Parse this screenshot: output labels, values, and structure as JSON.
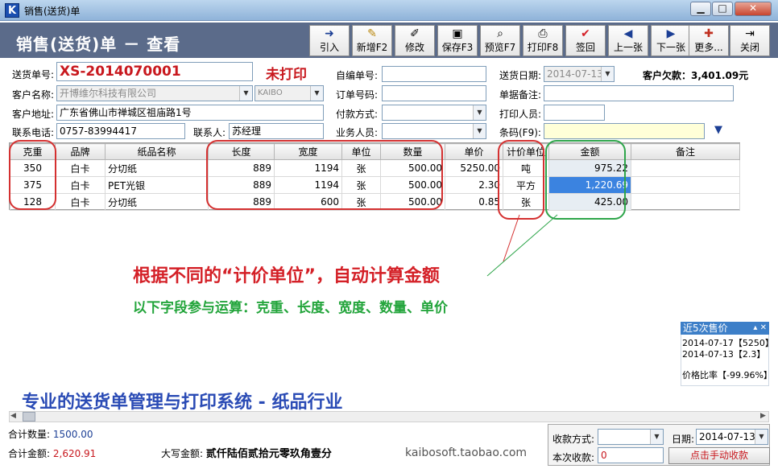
{
  "window": {
    "title": "销售(送货)单",
    "app_icon": "K"
  },
  "header": {
    "title": "销售(送货)单 － 查看"
  },
  "toolbar": [
    {
      "label": "引入",
      "icon": "➜"
    },
    {
      "label": "新增F2",
      "icon": "✎"
    },
    {
      "label": "修改",
      "icon": "✐"
    },
    {
      "label": "保存F3",
      "icon": "▣"
    },
    {
      "label": "预览F7",
      "icon": "⌕"
    },
    {
      "label": "打印F8",
      "icon": "⎙"
    },
    {
      "label": "签回",
      "icon": "✔"
    },
    {
      "label": "上一张",
      "icon": "◀"
    },
    {
      "label": "下一张",
      "icon": "▶"
    },
    {
      "label": "更多...",
      "icon": "✚"
    },
    {
      "label": "关闭",
      "icon": "⇥"
    }
  ],
  "form": {
    "order_no_label": "送货单号:",
    "order_no": "XS-2014070001",
    "print_status": "未打印",
    "customer_label": "客户名称:",
    "customer": "开博维尔科技有限公司",
    "customer_code": "KAIBO",
    "address_label": "客户地址:",
    "address": "广东省佛山市禅城区祖庙路1号",
    "phone_label": "联系电话:",
    "phone": "0757-83994417",
    "contact_label": "联系人:",
    "contact": "苏经理",
    "self_no_label": "自编单号:",
    "self_no": "",
    "po_no_label": "订单号码:",
    "po_no": "",
    "pay_method_label": "付款方式:",
    "pay_method": "",
    "sales_label": "业务人员:",
    "sales": "",
    "date_label": "送货日期:",
    "date": "2014-07-13",
    "remark_label": "单据备注:",
    "remark": "",
    "printer_label": "打印人员:",
    "printer": "",
    "barcode_label": "条码(F9):",
    "barcode": "",
    "debt_label": "客户欠款：",
    "debt": "3,401.09元"
  },
  "table": {
    "headers": [
      "克重",
      "品牌",
      "纸品名称",
      "长度",
      "宽度",
      "单位",
      "数量",
      "单价",
      "计价单位",
      "金额",
      "备注"
    ],
    "rows": [
      [
        "350",
        "白卡",
        "分切纸",
        "889",
        "1194",
        "张",
        "500.00",
        "5250.00",
        "吨",
        "975.22",
        ""
      ],
      [
        "375",
        "白卡",
        "PET光银",
        "889",
        "1194",
        "张",
        "500.00",
        "2.30",
        "平方",
        "1,220.69",
        ""
      ],
      [
        "128",
        "白卡",
        "分切纸",
        "889",
        "600",
        "张",
        "500.00",
        "0.85",
        "张",
        "425.00",
        ""
      ]
    ]
  },
  "annotations": {
    "line1": "根据不同的“计价单位”，自动计算金额",
    "line2": "以下字段参与运算：克重、长度、宽度、数量、单价",
    "promo": "专业的送货单管理与打印系统 - 纸品行业"
  },
  "recent": {
    "title": "近5次售价",
    "items": [
      "2014-07-17【5250】",
      "2014-07-13【2.3】"
    ],
    "ratio": "价格比率【-99.96%】"
  },
  "footer": {
    "qty_label": "合计数量:",
    "qty": "1500.00",
    "amount_label": "合计金额:",
    "amount": "2,620.91",
    "cap_label": "大写金额:",
    "cap": "贰仟陆佰贰拾元零玖角壹分",
    "shop": "kaibosoft.taobao.com",
    "collect_method_label": "收款方式:",
    "collect_method": "",
    "collect_date_label": "日期:",
    "collect_date": "2014-07-13",
    "received_label": "本次收款:",
    "received": "0",
    "collect_btn": "点击手动收款"
  },
  "colors": {
    "accent_red": "#c8181e",
    "header_bg": "#5b6b8a",
    "note_green": "#24a53c",
    "promo_blue": "#2a4bb5"
  }
}
